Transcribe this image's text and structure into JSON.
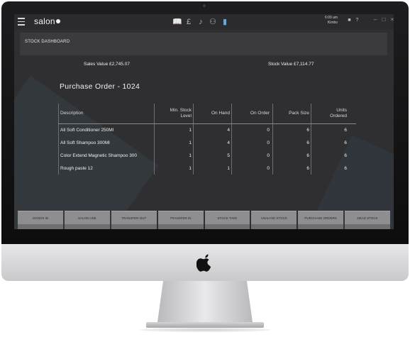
{
  "app": {
    "logo_text": "salon"
  },
  "topbar": {
    "icons": [
      "book-icon",
      "pound-icon",
      "music-icon",
      "people-icon",
      "chart-icon"
    ],
    "time": "6:09 am",
    "user": "Kimbo"
  },
  "dashboard": {
    "title": "STOCK DASHBOARD"
  },
  "summary": {
    "sales_value": "Sales Value £2,745.07",
    "stock_value": "Stock Value £7,114.77"
  },
  "purchase_order": {
    "title": "Purchase Order - 1024"
  },
  "table": {
    "headers": {
      "description": "Description",
      "min_stock": "Min. Stock\nLevel",
      "on_hand": "On Hand",
      "on_order": "On Order",
      "pack_size": "Pack Size",
      "units_ordered": "Units\nOrdered"
    },
    "rows": [
      {
        "description": "All Soft Conditioner 250Ml",
        "min_stock": "1",
        "on_hand": "4",
        "on_order": "0",
        "pack_size": "6",
        "units_ordered": "6"
      },
      {
        "description": "All Soft Shampoo 300Ml",
        "min_stock": "1",
        "on_hand": "4",
        "on_order": "0",
        "pack_size": "6",
        "units_ordered": "6"
      },
      {
        "description": "Color Extend Magnetic Shampoo 300",
        "min_stock": "1",
        "on_hand": "5",
        "on_order": "0",
        "pack_size": "6",
        "units_ordered": "6"
      },
      {
        "description": "Rough paste 12",
        "min_stock": "1",
        "on_hand": "1",
        "on_order": "0",
        "pack_size": "6",
        "units_ordered": "6"
      }
    ]
  },
  "actions": {
    "goods_in": "GOODS IN",
    "salon_use": "SALON USE",
    "transfer_out": "TRANSFER OUT",
    "transfer_in": "TRANSFER IN",
    "stock_take": "STOCK TAKE",
    "analyse_stock": "ANALYSE STOCK",
    "purchase_orders": "PURCHASE ORDERS",
    "dead_stock": "DEAD STOCK"
  },
  "colors": {
    "screen_bg": "#2f2f31",
    "accent": "#5fa8e0",
    "button": "#8e8e90"
  }
}
